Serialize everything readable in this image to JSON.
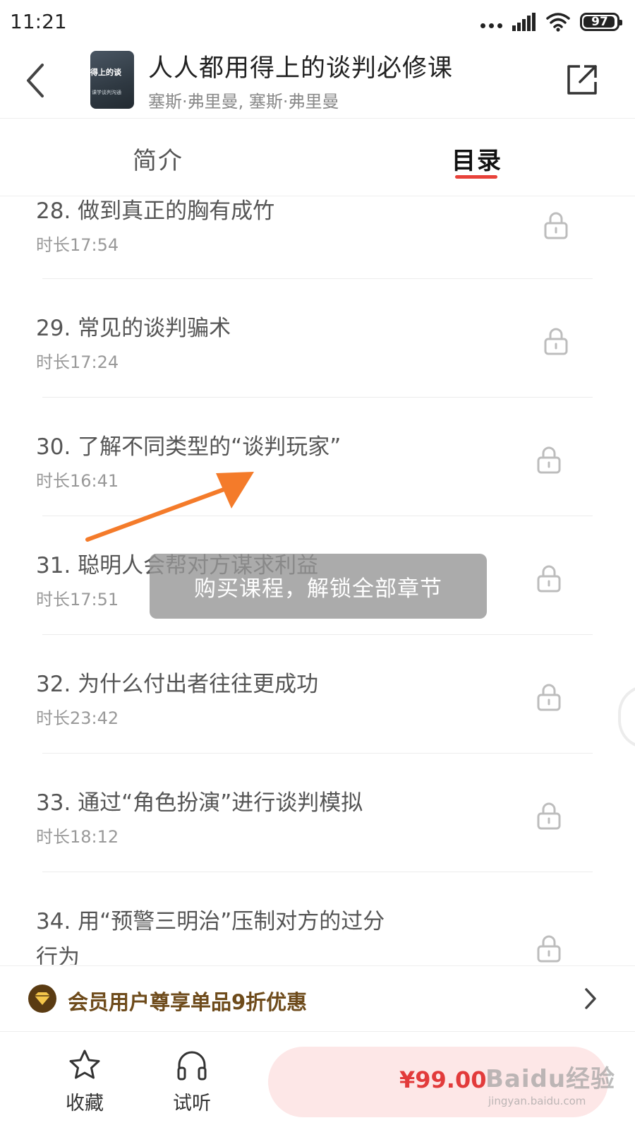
{
  "status_bar": {
    "time": "11:21",
    "battery": "97"
  },
  "header": {
    "title": "人人都用得上的谈判必修课",
    "authors": "塞斯·弗里曼, 塞斯·弗里曼",
    "cover_text_1": "得上的谈",
    "cover_text_2": "课学谈判沟通"
  },
  "tabs": [
    {
      "label": "简介",
      "active": false
    },
    {
      "label": "目录",
      "active": true
    }
  ],
  "lessons": [
    {
      "title": "28. 做到真正的胸有成竹",
      "duration": "时长17:54",
      "locked": true
    },
    {
      "title": "29. 常见的谈判骗术",
      "duration": "时长17:24",
      "locked": true
    },
    {
      "title": "30. 了解不同类型的“谈判玩家”",
      "duration": "时长16:41",
      "locked": true
    },
    {
      "title": "31. 聪明人会帮对方谋求利益",
      "duration": "时长17:51",
      "locked": true
    },
    {
      "title": "32. 为什么付出者往往更成功",
      "duration": "时长23:42",
      "locked": true
    },
    {
      "title": "33. 通过“角色扮演”进行谈判模拟",
      "duration": "时长18:12",
      "locked": true
    },
    {
      "title": "34. 用“预警三明治”压制对方的过分",
      "title_line2": "行为",
      "duration": "",
      "locked": true
    }
  ],
  "toast": {
    "message": "购买课程，解锁全部章节"
  },
  "member_bar": {
    "text": "会员用户尊享单品9折优惠"
  },
  "bottom_bar": {
    "favorite_label": "收藏",
    "listen_label": "试听",
    "price": "¥99.00"
  },
  "watermark": {
    "brand": "Baidu经验",
    "url": "jingyan.baidu.com"
  },
  "colors": {
    "accent_red": "#e8423a",
    "price_red": "#e23b3b",
    "buy_button_bg": "#fde7e7",
    "member_gold": "#6e4b1b",
    "annotation_orange": "#f47b2a"
  }
}
